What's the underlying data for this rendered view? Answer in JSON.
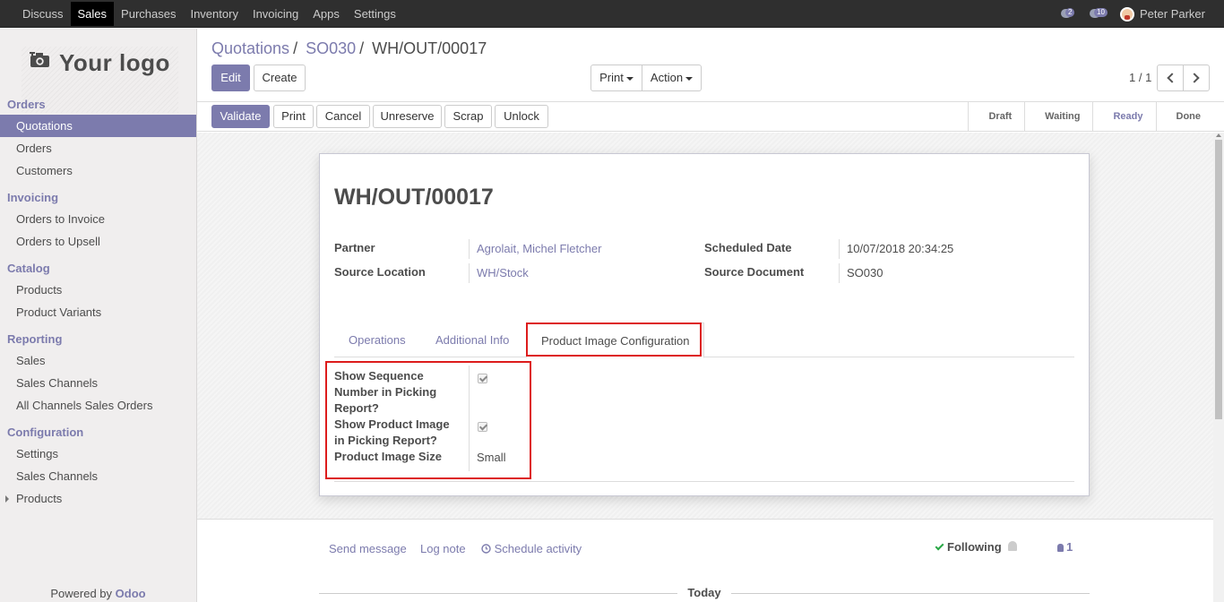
{
  "topbar": {
    "menu": [
      "Discuss",
      "Sales",
      "Purchases",
      "Inventory",
      "Invoicing",
      "Apps",
      "Settings"
    ],
    "active_menu": "Sales",
    "messages_count": "2",
    "activity_count": "10",
    "user_name": "Peter Parker"
  },
  "sidebar": {
    "logo_text": "Your logo",
    "sections": [
      {
        "title": "Orders",
        "items": [
          "Quotations",
          "Orders",
          "Customers"
        ]
      },
      {
        "title": "Invoicing",
        "items": [
          "Orders to Invoice",
          "Orders to Upsell"
        ]
      },
      {
        "title": "Catalog",
        "items": [
          "Products",
          "Product Variants"
        ]
      },
      {
        "title": "Reporting",
        "items": [
          "Sales",
          "Sales Channels",
          "All Channels Sales Orders"
        ]
      },
      {
        "title": "Configuration",
        "items": [
          "Settings",
          "Sales Channels",
          "Products"
        ]
      }
    ],
    "active_item": "Quotations",
    "powered_by": "Powered by",
    "powered_brand": "Odoo"
  },
  "breadcrumb": {
    "items": [
      "Quotations",
      "SO030"
    ],
    "current": "WH/OUT/00017"
  },
  "toolbar": {
    "edit_label": "Edit",
    "create_label": "Create",
    "print_label": "Print",
    "action_label": "Action",
    "pager_value": "1 / 1"
  },
  "statusbar": {
    "buttons": [
      "Validate",
      "Print",
      "Cancel",
      "Unreserve",
      "Scrap",
      "Unlock"
    ],
    "stages": [
      "Draft",
      "Waiting",
      "Ready",
      "Done"
    ],
    "current_stage": "Ready"
  },
  "record": {
    "name": "WH/OUT/00017",
    "partner_label": "Partner",
    "partner_value": "Agrolait, Michel Fletcher",
    "source_location_label": "Source Location",
    "source_location_value": "WH/Stock",
    "scheduled_date_label": "Scheduled Date",
    "scheduled_date_value": "10/07/2018 20:34:25",
    "source_document_label": "Source Document",
    "source_document_value": "SO030"
  },
  "tabs": [
    "Operations",
    "Additional Info",
    "Product Image Configuration"
  ],
  "active_tab": "Product Image Configuration",
  "config": {
    "show_sequence_label_1": "Show Sequence",
    "show_sequence_label_2": "Number in Picking",
    "show_sequence_label_3": "Report?",
    "show_sequence_checked": true,
    "show_image_label_1": "Show Product Image",
    "show_image_label_2": "in Picking Report?",
    "show_image_checked": true,
    "image_size_label": "Product Image Size",
    "image_size_value": "Small"
  },
  "chatter": {
    "send_message": "Send message",
    "log_note": "Log note",
    "schedule_activity": "Schedule activity",
    "following": "Following",
    "followers_count": "1",
    "today": "Today"
  },
  "colors": {
    "accent": "#7c7bad",
    "topbar": "#2f2f2f",
    "highlight": "#dd1c1c"
  }
}
